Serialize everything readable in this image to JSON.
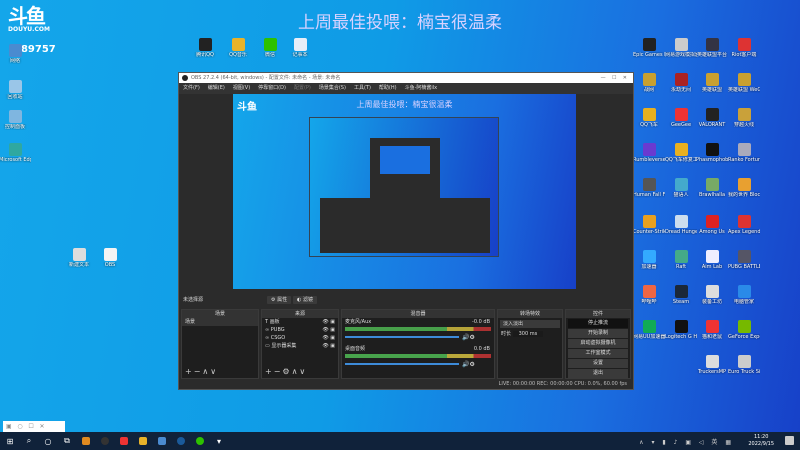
{
  "stream_overlay": {
    "logo_text": "斗鱼",
    "logo_domain": "DOUYU.COM",
    "room_number": "289757",
    "banner": "上周最佳投喂：楠宝很温柔"
  },
  "desktop_left": [
    {
      "label": "网络",
      "color": "#4a8bd0"
    },
    {
      "label": "回收站",
      "color": "#9ac6e8"
    },
    {
      "label": "控制面板",
      "color": "#7fb6e0"
    },
    {
      "label": "Microsoft Edge",
      "color": "#2fa8a0"
    }
  ],
  "desktop_top": [
    {
      "label": "腾讯QQ",
      "color": "#222"
    },
    {
      "label": "QQ音乐",
      "color": "#e8b32a"
    },
    {
      "label": "微信",
      "color": "#2dc100"
    },
    {
      "label": "记事本",
      "color": "#e8eef8"
    }
  ],
  "desktop_mid": [
    {
      "label": "新建文本",
      "color": "#ddd"
    },
    {
      "label": "OBS",
      "color": "#f4f4f4"
    }
  ],
  "desktop_right": [
    {
      "label": "Epic Games Launcher",
      "color": "#222"
    },
    {
      "label": "网易游戏模拟器",
      "color": "#ccc"
    },
    {
      "label": "英雄联盟平台",
      "color": "#334"
    },
    {
      "label": "Riot客户端",
      "color": "#d33"
    },
    {
      "label": "战网",
      "color": "#c8a030"
    },
    {
      "label": "永劫无间",
      "color": "#a22"
    },
    {
      "label": "英雄联盟",
      "color": "#c8a030"
    },
    {
      "label": "英雄联盟 WeGame版",
      "color": "#c8a030"
    },
    {
      "label": "QQ飞车",
      "color": "#e8b020"
    },
    {
      "label": "GeeGee",
      "color": "#e33"
    },
    {
      "label": "VALORANT",
      "color": "#222"
    },
    {
      "label": "穿越火线",
      "color": "#c9a13a"
    },
    {
      "label": "Rumbleverse",
      "color": "#6a3ad0"
    },
    {
      "label": "QQ飞车修复工具",
      "color": "#e8b020"
    },
    {
      "label": "Phasmophobia",
      "color": "#111"
    },
    {
      "label": "Ranko Fortune",
      "color": "#aab"
    },
    {
      "label": "Human Fall Flat",
      "color": "#555"
    },
    {
      "label": "猫语人",
      "color": "#4ac"
    },
    {
      "label": "Brawlhalla",
      "color": "#7a6"
    },
    {
      "label": "我的世界 Blockman",
      "color": "#e8a030"
    },
    {
      "label": "Counter-Strike Global Off...",
      "color": "#e8a020"
    },
    {
      "label": "Dread Hunger",
      "color": "#cde"
    },
    {
      "label": "Among Us",
      "color": "#d22"
    },
    {
      "label": "Apex Legends",
      "color": "#d33"
    },
    {
      "label": "加速器",
      "color": "#3af"
    },
    {
      "label": "Raft",
      "color": "#4a8"
    },
    {
      "label": "Aim Lab",
      "color": "#eef"
    },
    {
      "label": "PUBG BATTLEGR...",
      "color": "#556"
    },
    {
      "label": "哔哩哔",
      "color": "#e64"
    },
    {
      "label": "Steam",
      "color": "#1b2838"
    },
    {
      "label": "装备工坊",
      "color": "#ddd"
    },
    {
      "label": "电脑管家",
      "color": "#2a8ae8"
    },
    {
      "label": "网易UU加速器",
      "color": "#1a5"
    },
    {
      "label": "Logitech G HUB",
      "color": "#111"
    },
    {
      "label": "猫和老鼠",
      "color": "#e33"
    },
    {
      "label": "GeForce Experience",
      "color": "#76b900"
    },
    {
      "label": "TruckersMP",
      "color": "#ddd"
    },
    {
      "label": "Euro Truck Simulator 2",
      "color": "#ccc"
    }
  ],
  "obs": {
    "title": "OBS 27.2.4 (64-bit, windows) - 配置文件: 未命名 - 场景: 未命名",
    "menu": [
      "文件(F)",
      "编辑(E)",
      "视图(V)",
      "停靠窗口(D)",
      "配置(P)",
      "场景集合(S)",
      "工具(T)",
      "帮助(H)",
      "斗鱼-阿楠酱ilx"
    ],
    "preview_banner": "上周最佳投喂：楠宝很温柔",
    "selected_label": "未选择源",
    "props_btn": "属性",
    "filters_btn": "滤镜",
    "docks": {
      "scenes": "场景",
      "sources": "来源",
      "mixer": "混音器",
      "transitions": "转场特效",
      "controls": "控件"
    },
    "scenes": [
      "场景"
    ],
    "sources": [
      {
        "icon": "T",
        "name": "画板"
      },
      {
        "icon": "∞",
        "name": "PUBG"
      },
      {
        "icon": "∞",
        "name": "CSGO"
      },
      {
        "icon": "▭",
        "name": "显示器采集"
      }
    ],
    "mixer": [
      {
        "name": "麦克风/Aux",
        "db": "-0.0 dB",
        "level": 0.72
      },
      {
        "name": "桌面音频",
        "db": "0.0 dB",
        "level": 0.8
      }
    ],
    "transition": {
      "type": "淡入淡出",
      "duration_label": "时长",
      "duration": "300 ms"
    },
    "controls": [
      "停止推流",
      "开始录制",
      "启动虚拟摄像机",
      "工作室模式",
      "设置",
      "退出"
    ],
    "status": "LIVE: 00:00:00   REC: 00:00:00   CPU: 0.0%, 60.00 fps"
  },
  "taskbar": {
    "time": "11:20",
    "date": "2022/9/15"
  }
}
